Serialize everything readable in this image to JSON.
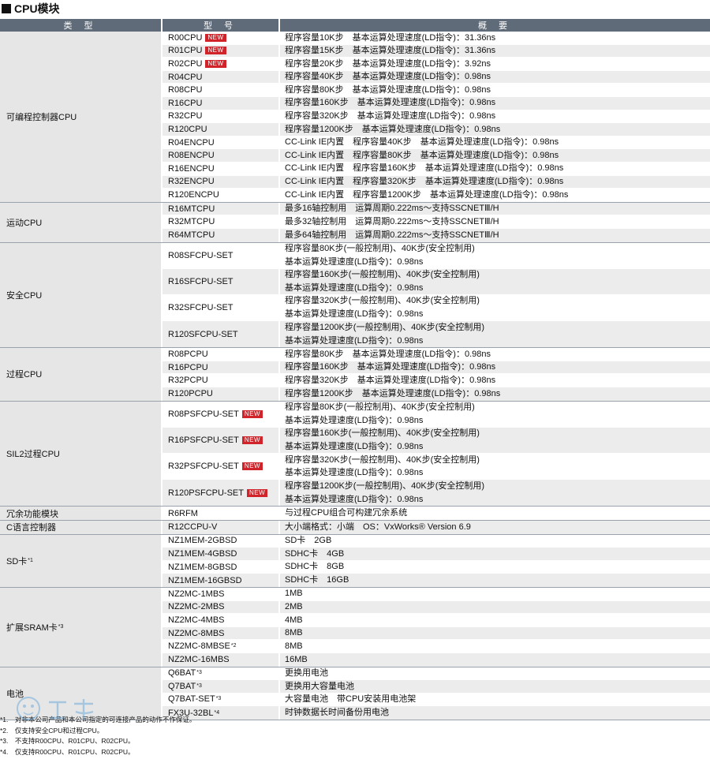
{
  "title": "CPU模块",
  "headers": [
    "类 型",
    "型 号",
    "概 要"
  ],
  "new_badge": "NEW",
  "groups": [
    {
      "category": "可编程控制器CPU",
      "rows": [
        {
          "model": "R00CPU",
          "is_new": true,
          "desc": [
            "程序容量10K步　基本运算处理速度(LD指令)：31.36ns"
          ]
        },
        {
          "model": "R01CPU",
          "is_new": true,
          "desc": [
            "程序容量15K步　基本运算处理速度(LD指令)：31.36ns"
          ]
        },
        {
          "model": "R02CPU",
          "is_new": true,
          "desc": [
            "程序容量20K步　基本运算处理速度(LD指令)：3.92ns"
          ]
        },
        {
          "model": "R04CPU",
          "desc": [
            "程序容量40K步　基本运算处理速度(LD指令)：0.98ns"
          ]
        },
        {
          "model": "R08CPU",
          "desc": [
            "程序容量80K步　基本运算处理速度(LD指令)：0.98ns"
          ]
        },
        {
          "model": "R16CPU",
          "desc": [
            "程序容量160K步　基本运算处理速度(LD指令)：0.98ns"
          ]
        },
        {
          "model": "R32CPU",
          "desc": [
            "程序容量320K步　基本运算处理速度(LD指令)：0.98ns"
          ]
        },
        {
          "model": "R120CPU",
          "desc": [
            "程序容量1200K步　基本运算处理速度(LD指令)：0.98ns"
          ]
        },
        {
          "model": "R04ENCPU",
          "desc": [
            "CC-Link IE内置　程序容量40K步　基本运算处理速度(LD指令)：0.98ns"
          ]
        },
        {
          "model": "R08ENCPU",
          "desc": [
            "CC-Link IE内置　程序容量80K步　基本运算处理速度(LD指令)：0.98ns"
          ]
        },
        {
          "model": "R16ENCPU",
          "desc": [
            "CC-Link IE内置　程序容量160K步　基本运算处理速度(LD指令)：0.98ns"
          ]
        },
        {
          "model": "R32ENCPU",
          "desc": [
            "CC-Link IE内置　程序容量320K步　基本运算处理速度(LD指令)：0.98ns"
          ]
        },
        {
          "model": "R120ENCPU",
          "desc": [
            "CC-Link IE内置　程序容量1200K步　基本运算处理速度(LD指令)：0.98ns"
          ]
        }
      ]
    },
    {
      "category": "运动CPU",
      "rows": [
        {
          "model": "R16MTCPU",
          "desc": [
            "最多16轴控制用　运算周期0.222ms～支持SSCNETⅢ/H"
          ]
        },
        {
          "model": "R32MTCPU",
          "desc": [
            "最多32轴控制用　运算周期0.222ms～支持SSCNETⅢ/H"
          ]
        },
        {
          "model": "R64MTCPU",
          "desc": [
            "最多64轴控制用　运算周期0.222ms～支持SSCNETⅢ/H"
          ]
        }
      ]
    },
    {
      "category": "安全CPU",
      "rows": [
        {
          "model": "R08SFCPU-SET",
          "desc": [
            "程序容量80K步(一般控制用)、40K步(安全控制用)",
            "基本运算处理速度(LD指令)：0.98ns"
          ]
        },
        {
          "model": "R16SFCPU-SET",
          "desc": [
            "程序容量160K步(一般控制用)、40K步(安全控制用)",
            "基本运算处理速度(LD指令)：0.98ns"
          ]
        },
        {
          "model": "R32SFCPU-SET",
          "desc": [
            "程序容量320K步(一般控制用)、40K步(安全控制用)",
            "基本运算处理速度(LD指令)：0.98ns"
          ]
        },
        {
          "model": "R120SFCPU-SET",
          "desc": [
            "程序容量1200K步(一般控制用)、40K步(安全控制用)",
            "基本运算处理速度(LD指令)：0.98ns"
          ]
        }
      ]
    },
    {
      "category": "过程CPU",
      "rows": [
        {
          "model": "R08PCPU",
          "desc": [
            "程序容量80K步　基本运算处理速度(LD指令)：0.98ns"
          ]
        },
        {
          "model": "R16PCPU",
          "desc": [
            "程序容量160K步　基本运算处理速度(LD指令)：0.98ns"
          ]
        },
        {
          "model": "R32PCPU",
          "desc": [
            "程序容量320K步　基本运算处理速度(LD指令)：0.98ns"
          ]
        },
        {
          "model": "R120PCPU",
          "desc": [
            "程序容量1200K步　基本运算处理速度(LD指令)：0.98ns"
          ]
        }
      ]
    },
    {
      "category": "SIL2过程CPU",
      "rows": [
        {
          "model": "R08PSFCPU-SET",
          "is_new": true,
          "desc": [
            "程序容量80K步(一般控制用)、40K步(安全控制用)",
            "基本运算处理速度(LD指令)：0.98ns"
          ]
        },
        {
          "model": "R16PSFCPU-SET",
          "is_new": true,
          "desc": [
            "程序容量160K步(一般控制用)、40K步(安全控制用)",
            "基本运算处理速度(LD指令)：0.98ns"
          ]
        },
        {
          "model": "R32PSFCPU-SET",
          "is_new": true,
          "desc": [
            "程序容量320K步(一般控制用)、40K步(安全控制用)",
            "基本运算处理速度(LD指令)：0.98ns"
          ]
        },
        {
          "model": "R120PSFCPU-SET",
          "is_new": true,
          "desc": [
            "程序容量1200K步(一般控制用)、40K步(安全控制用)",
            "基本运算处理速度(LD指令)：0.98ns"
          ]
        }
      ]
    },
    {
      "category": "冗余功能模块",
      "rows": [
        {
          "model": "R6RFM",
          "desc": [
            "与过程CPU组合可构建冗余系统"
          ]
        }
      ]
    },
    {
      "category": "C语言控制器",
      "rows": [
        {
          "model": "R12CCPU-V",
          "desc": [
            "大小端格式：小端　OS：VxWorks® Version 6.9"
          ]
        }
      ]
    },
    {
      "category": "SD卡",
      "category_sup": "*1",
      "rows": [
        {
          "model": "NZ1MEM-2GBSD",
          "desc": [
            "SD卡　2GB"
          ]
        },
        {
          "model": "NZ1MEM-4GBSD",
          "desc": [
            "SDHC卡　4GB"
          ]
        },
        {
          "model": "NZ1MEM-8GBSD",
          "desc": [
            "SDHC卡　8GB"
          ]
        },
        {
          "model": "NZ1MEM-16GBSD",
          "desc": [
            "SDHC卡　16GB"
          ]
        }
      ]
    },
    {
      "category": "扩展SRAM卡",
      "category_sup": "*3",
      "rows": [
        {
          "model": "NZ2MC-1MBS",
          "desc": [
            "1MB"
          ]
        },
        {
          "model": "NZ2MC-2MBS",
          "desc": [
            "2MB"
          ]
        },
        {
          "model": "NZ2MC-4MBS",
          "desc": [
            "4MB"
          ]
        },
        {
          "model": "NZ2MC-8MBS",
          "desc": [
            "8MB"
          ]
        },
        {
          "model": "NZ2MC-8MBSE",
          "sup": "*2",
          "desc": [
            "8MB"
          ]
        },
        {
          "model": "NZ2MC-16MBS",
          "desc": [
            "16MB"
          ]
        }
      ]
    },
    {
      "category": "电池",
      "rows": [
        {
          "model": "Q6BAT",
          "sup": "*3",
          "desc": [
            "更换用电池"
          ]
        },
        {
          "model": "Q7BAT",
          "sup": "*3",
          "desc": [
            "更换用大容量电池"
          ]
        },
        {
          "model": "Q7BAT-SET",
          "sup": "*3",
          "desc": [
            "大容量电池　带CPU安装用电池架"
          ]
        },
        {
          "model": "FX3U-32BL",
          "sup": "*4",
          "desc": [
            "时钟数据长时间备份用电池"
          ]
        }
      ]
    }
  ],
  "notes": [
    "*1.　对非本公司产品和本公司指定的可连接产品的动作不作保证。",
    "*2.　仅支持安全CPU和过程CPU。",
    "*3.　不支持R00CPU、R01CPU、R02CPU。",
    "*4.　仅支持R00CPU、R01CPU、R02CPU。"
  ],
  "colors": {
    "header_bg": "#5f6b78",
    "new_badge": "#d1232a",
    "row_alt": "#ececec",
    "category_bg": "#e6e6e6"
  }
}
